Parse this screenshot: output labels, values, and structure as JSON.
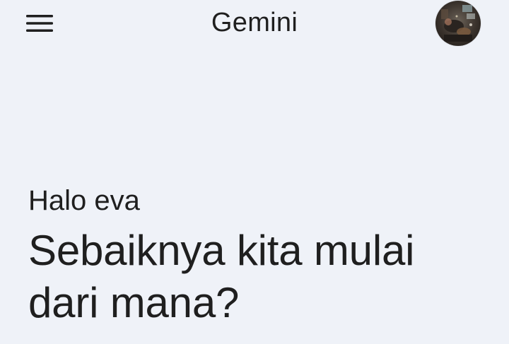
{
  "header": {
    "title": "Gemini",
    "menu_icon": "hamburger-menu-icon",
    "avatar_icon": "profile-avatar"
  },
  "main": {
    "greeting": "Halo eva",
    "headline": "Sebaiknya kita mulai dari mana?"
  },
  "colors": {
    "background": "#eff2f8",
    "text": "#1f1f1f"
  }
}
